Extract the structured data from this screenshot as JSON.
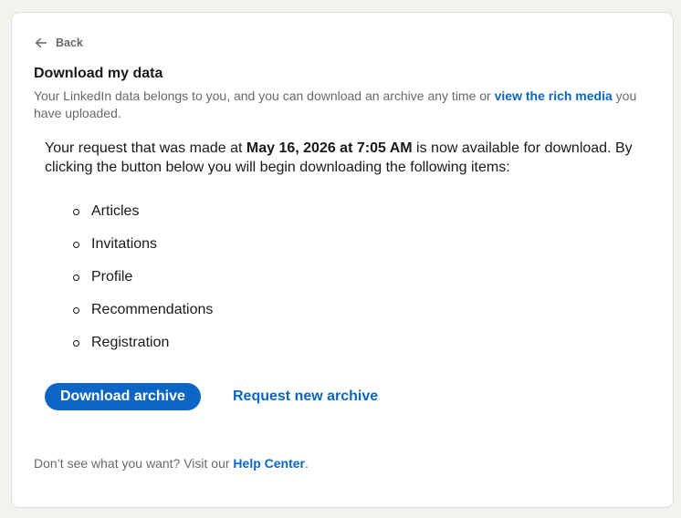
{
  "back": {
    "label": "Back",
    "icon": "arrow-left-icon"
  },
  "header": {
    "title": "Download my data",
    "subtitle_prefix": "Your LinkedIn data belongs to you, and you can download an archive any time or ",
    "subtitle_link": "view the rich media",
    "subtitle_suffix": " you have uploaded."
  },
  "request": {
    "prefix": "Your request that was made at ",
    "date": "May 16, 2026 at 7:05 AM",
    "suffix": " is now available for download. By clicking the button below you will begin downloading the following items:"
  },
  "items": [
    "Articles",
    "Invitations",
    "Profile",
    "Recommendations",
    "Registration"
  ],
  "actions": {
    "download_label": "Download archive",
    "request_new_label": "Request new archive"
  },
  "footer": {
    "prefix": "Don’t see what you want? Visit our ",
    "link": "Help Center",
    "suffix": "."
  },
  "colors": {
    "accent": "#0a66c2",
    "background": "#f4f2ee",
    "card": "#ffffff"
  }
}
